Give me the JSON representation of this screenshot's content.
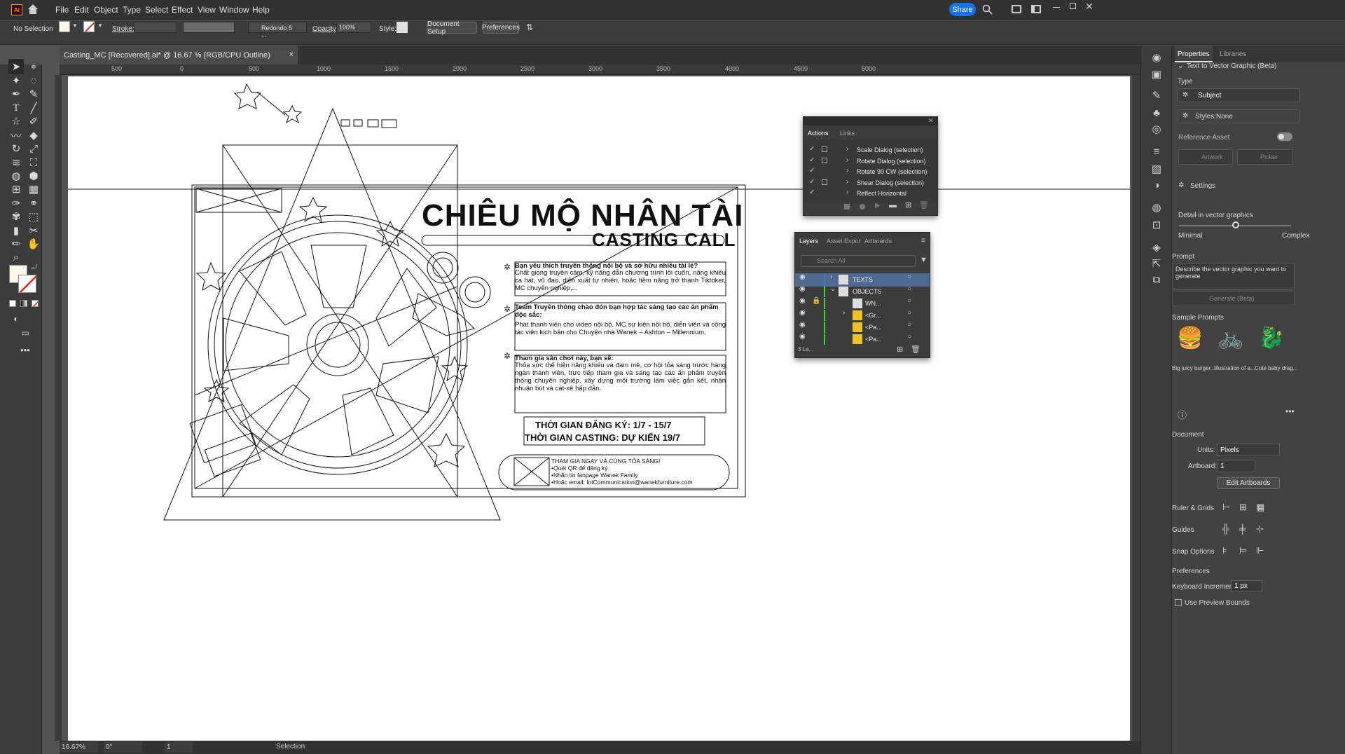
{
  "menubar": {
    "app_logo": "Ai",
    "items": [
      "File",
      "Edit",
      "Object",
      "Type",
      "Select",
      "Effect",
      "View",
      "Window",
      "Help"
    ],
    "share_label": "Share"
  },
  "control_bar": {
    "selection": "No Selection",
    "stroke_label": "Stroke:",
    "brush_name": "Redondo 5 ...",
    "opacity_label": "Opacity:",
    "opacity_value": "100%",
    "style_label": "Style:",
    "document_setup": "Document Setup",
    "preferences": "Preferences"
  },
  "doc_tab": {
    "title": "Casting_MC [Recovered].ai* @ 16.67 % (RGB/CPU Outline)",
    "close": "×"
  },
  "ruler_ticks": [
    "500",
    "0",
    "500",
    "1000",
    "1500",
    "2000",
    "2500",
    "3000",
    "3500",
    "4000",
    "4500",
    "5000"
  ],
  "artwork": {
    "headline": "CHIÊU MỘ NHÂN TÀI",
    "subheadline": "CASTING CALL",
    "b1_title": "Bạn yêu thích truyền thông nội bộ và sở hữu nhiều tài lẻ?",
    "b1_body": "Chất giọng truyền cảm, kỹ năng dẫn chương trình lôi cuốn, năng khiếu ca hát, vũ đạo, diễn xuất tự nhiên, hoặc tiềm năng trở thành Tiktoker, MC chuyên nghiệp,...",
    "b2_title": "Team Truyền thông chào đón bạn hợp tác sáng tạo các ấn phẩm độc sắc:",
    "b2_body": "Phát thanh viên cho video nội bộ, MC sự kiện nội bộ, diễn viên và cộng tác viên kịch bản cho Chuyện nhà Wanek – Ashton – Millennium.",
    "b3_title": "Tham gia sân chơi này, bạn sẽ:",
    "b3_body": "Thỏa sức thể hiện năng khiếu và đam mê, cơ hội tỏa sáng trước hàng ngàn thành viên, trực tiếp tham gia và sáng tạo các ấn phẩm truyền thông chuyên nghiệp, xây dựng môi trường làm việc gắn kết, nhận nhuận bút và cát-xê hấp dẫn.",
    "date1": "THỜI GIAN ĐĂNG KÝ: 1/7 - 15/7",
    "date2": "THỜI GIAN CASTING: DỰ KIẾN 19/7",
    "cta_title": "THAM GIA NGAY VÀ CÙNG TỎA SÁNG!",
    "cta_1": "•Quét QR để đăng ký",
    "cta_2": "•Nhắn tin fanpage Wanek Family",
    "cta_3": "•Hoặc email: IntCommunication@wanekfurniture.com"
  },
  "actions_panel": {
    "tabs": [
      "Actions",
      "Links"
    ],
    "rows": [
      "Scale Dialog (selection)",
      "Rotate Dialog (selection)",
      "Rotate 90 CW (selection)",
      "Shear Dialog (selection)",
      "Reflect Horizontal"
    ]
  },
  "layers_panel": {
    "tabs": [
      "Layers",
      "Asset Expor",
      "Artboards"
    ],
    "search_placeholder": "Search All",
    "rows": [
      "TEXTS",
      "OBJECTS",
      "WN...",
      "<Gr...",
      "<Pa...",
      "<Pa..."
    ],
    "footer_count": "3 La..."
  },
  "properties": {
    "tabs": [
      "Properties",
      "Libraries"
    ],
    "section": "Text to Vector Graphic (Beta)",
    "type_label": "Type",
    "type_value": "Subject",
    "styles_label": "Styles:",
    "styles_value": "None",
    "ref_asset": "Reference Asset",
    "artwork_btn": "Artwork",
    "picker_btn": "Picker",
    "settings": "Settings",
    "detail_label": "Detail in vector graphics",
    "detail_level": 0.5,
    "minimal": "Minimal",
    "complex": "Complex",
    "prompt_label": "Prompt",
    "prompt_placeholder": "Describe the vector graphic you want to generate",
    "generate_btn": "Generate (Beta)",
    "sample_prompts": "Sample Prompts",
    "samples": [
      "Big juicy burger...",
      "Illustration of a...",
      "Cute baby drag..."
    ],
    "document": "Document",
    "units_label": "Units:",
    "units_value": "Pixels",
    "artboard_label": "Artboard:",
    "artboard_value": "1",
    "edit_artboards": "Edit Artboards",
    "ruler_grids": "Ruler & Grids",
    "guides": "Guides",
    "snap_options": "Snap Options",
    "preferences": "Preferences",
    "keyboard_increment": "Keyboard Increment:",
    "keyboard_value": "1 px",
    "use_preview_bounds": "Use Preview Bounds"
  },
  "status": {
    "zoom": "16.67%",
    "angle": "0°",
    "artboard_nav": "1",
    "tool": "Selection"
  },
  "colors": {
    "accent": "#1473e6",
    "panel": "#424242",
    "dark": "#323232",
    "layer_blue": "#3b7bd8"
  }
}
